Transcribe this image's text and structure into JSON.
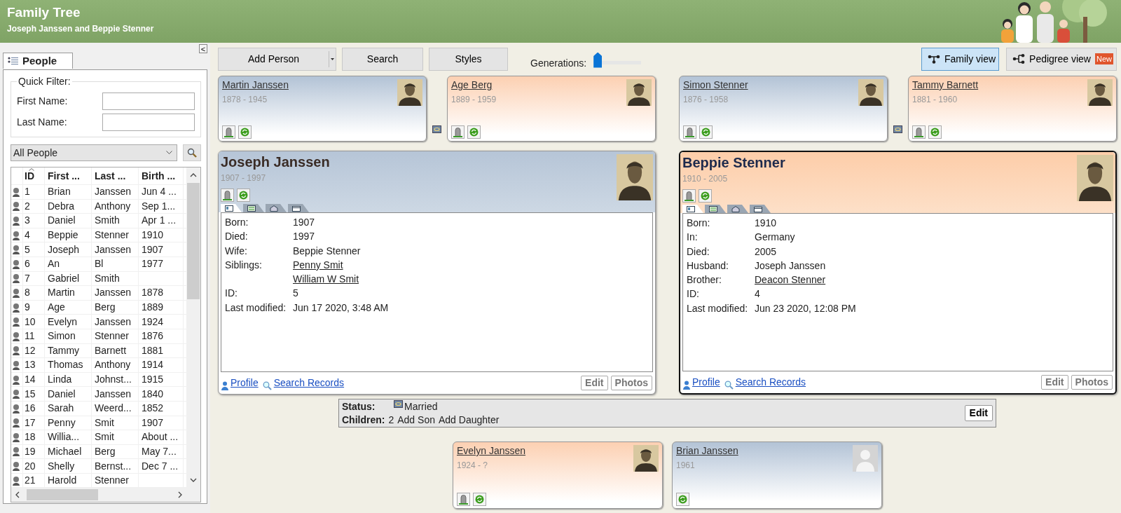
{
  "app": {
    "title": "Family Tree",
    "subtitle": "Joseph Janssen and Beppie Stenner"
  },
  "sidebar": {
    "collapse": "<",
    "tab": {
      "label": "People",
      "selected": true
    },
    "quick_filter": {
      "legend": "Quick Filter:",
      "fields": [
        {
          "label": "First Name:"
        },
        {
          "label": "Last Name:"
        }
      ]
    },
    "filter_select": "All People",
    "table": {
      "columns": [
        {
          "label": "ID",
          "sorted": true
        },
        {
          "label": "First ...",
          "sorted": false
        },
        {
          "label": "Last ...",
          "sorted": false
        },
        {
          "label": "Birth ...",
          "sorted": false
        }
      ],
      "rows": [
        {
          "id": "1",
          "first": "Brian",
          "last": "Janssen",
          "birth": "Jun 4 ..."
        },
        {
          "id": "2",
          "first": "Debra",
          "last": "Anthony",
          "birth": "Sep 1..."
        },
        {
          "id": "3",
          "first": "Daniel",
          "last": "Smith",
          "birth": "Apr 1 ..."
        },
        {
          "id": "4",
          "first": "Beppie",
          "last": "Stenner",
          "birth": "1910"
        },
        {
          "id": "5",
          "first": "Joseph",
          "last": "Janssen",
          "birth": "1907"
        },
        {
          "id": "6",
          "first": "An",
          "last": "Bl",
          "birth": "1977"
        },
        {
          "id": "7",
          "first": "Gabriel",
          "last": "Smith",
          "birth": ""
        },
        {
          "id": "8",
          "first": "Martin",
          "last": "Janssen",
          "birth": "1878"
        },
        {
          "id": "9",
          "first": "Age",
          "last": "Berg",
          "birth": "1889"
        },
        {
          "id": "10",
          "first": "Evelyn",
          "last": "Janssen",
          "birth": "1924"
        },
        {
          "id": "11",
          "first": "Simon",
          "last": "Stenner",
          "birth": "1876"
        },
        {
          "id": "12",
          "first": "Tammy",
          "last": "Barnett",
          "birth": "1881"
        },
        {
          "id": "13",
          "first": "Thomas",
          "last": "Anthony",
          "birth": "1914"
        },
        {
          "id": "14",
          "first": "Linda",
          "last": "Johnst...",
          "birth": "1915"
        },
        {
          "id": "15",
          "first": "Daniel",
          "last": "Janssen",
          "birth": "1840"
        },
        {
          "id": "16",
          "first": "Sarah",
          "last": "Weerd...",
          "birth": "1852"
        },
        {
          "id": "17",
          "first": "Penny",
          "last": "Smit",
          "birth": "1907"
        },
        {
          "id": "18",
          "first": "Willia...",
          "last": "Smit",
          "birth": "About ..."
        },
        {
          "id": "19",
          "first": "Michael",
          "last": "Berg",
          "birth": "May 7..."
        },
        {
          "id": "20",
          "first": "Shelly",
          "last": "Bernst...",
          "birth": "Dec 7 ..."
        },
        {
          "id": "21",
          "first": "Harold",
          "last": "Stenner",
          "birth": ""
        }
      ]
    }
  },
  "toolbar": {
    "buttons": [
      {
        "label": "Add Person",
        "dropdown": true
      },
      {
        "label": "Search",
        "dropdown": false
      },
      {
        "label": "Styles",
        "dropdown": false
      }
    ],
    "generations": {
      "label": "Generations:",
      "level": 0
    },
    "views": [
      {
        "label": "Family view",
        "selected": true
      },
      {
        "label": "Pedigree view",
        "selected": false,
        "badge": "New"
      }
    ]
  },
  "parent_couples": [
    {
      "partners": [
        {
          "name": "Martin Janssen",
          "dates": "1878 - 1945",
          "kind": "male",
          "deceased": true,
          "has_photo": true
        },
        {
          "name": "Age Berg",
          "dates": "1889 - 1959",
          "kind": "female",
          "deceased": true,
          "has_photo": true
        }
      ]
    },
    {
      "partners": [
        {
          "name": "Simon Stenner",
          "dates": "1876 - 1958",
          "kind": "male",
          "deceased": true,
          "has_photo": true
        },
        {
          "name": "Tammy Barnett",
          "dates": "1881 - 1960",
          "kind": "female",
          "deceased": true,
          "has_photo": true
        }
      ]
    }
  ],
  "couple": [
    {
      "name": "Joseph Janssen",
      "dates": "1907 - 1997",
      "kind": "male",
      "deceased": true,
      "has_photo": true,
      "selected": false,
      "tabs": [
        {
          "selected": true
        },
        {
          "selected": false
        },
        {
          "selected": false
        },
        {
          "selected": false
        }
      ],
      "details": [
        {
          "label": "Born:",
          "values": [
            {
              "text": "1907",
              "link": false
            }
          ]
        },
        {
          "label": "Died:",
          "values": [
            {
              "text": "1997",
              "link": false
            }
          ]
        },
        {
          "label": "Wife:",
          "values": [
            {
              "text": "Beppie Stenner",
              "link": false
            }
          ]
        },
        {
          "label": "Siblings:",
          "values": [
            {
              "text": "Penny Smit",
              "link": true
            },
            {
              "text": "William W Smit",
              "link": true
            }
          ]
        },
        {
          "label": "ID:",
          "values": [
            {
              "text": "5",
              "link": false
            }
          ]
        },
        {
          "label": "Last modified:",
          "values": [
            {
              "text": "Jun 17 2020, 3:48 AM",
              "link": false
            }
          ]
        }
      ],
      "links": [
        "Profile",
        "Search Records"
      ],
      "buttons": [
        "Edit",
        "Photos"
      ]
    },
    {
      "name": "Beppie Stenner",
      "dates": "1910 - 2005",
      "kind": "female",
      "deceased": true,
      "has_photo": true,
      "selected": true,
      "tabs": [
        {
          "selected": true
        },
        {
          "selected": false
        },
        {
          "selected": false
        },
        {
          "selected": false
        }
      ],
      "details": [
        {
          "label": "Born:",
          "values": [
            {
              "text": "1910",
              "link": false
            }
          ]
        },
        {
          "label": "In:",
          "values": [
            {
              "text": "Germany",
              "link": false
            }
          ]
        },
        {
          "label": "Died:",
          "values": [
            {
              "text": "2005",
              "link": false
            }
          ]
        },
        {
          "label": "Husband:",
          "values": [
            {
              "text": "Joseph Janssen",
              "link": false
            }
          ]
        },
        {
          "label": "Brother:",
          "values": [
            {
              "text": "Deacon Stenner",
              "link": true
            }
          ]
        },
        {
          "label": "ID:",
          "values": [
            {
              "text": "4",
              "link": false
            }
          ]
        },
        {
          "label": "Last modified:",
          "values": [
            {
              "text": "Jun 23 2020, 12:08 PM",
              "link": false
            }
          ]
        }
      ],
      "links": [
        "Profile",
        "Search Records"
      ],
      "buttons": [
        "Edit",
        "Photos"
      ]
    }
  ],
  "family": {
    "status_label": "Status:",
    "status": "Married",
    "children_label": "Children:",
    "children_count": "2",
    "actions": [
      "Add Son",
      "Add Daughter"
    ],
    "edit": "Edit"
  },
  "children": [
    {
      "name": "Evelyn Janssen",
      "dates": "1924 - ?",
      "kind": "female",
      "deceased": true,
      "has_photo": true
    },
    {
      "name": "Brian Janssen",
      "dates": "1961",
      "kind": "male",
      "deceased": false,
      "has_photo": false
    }
  ]
}
